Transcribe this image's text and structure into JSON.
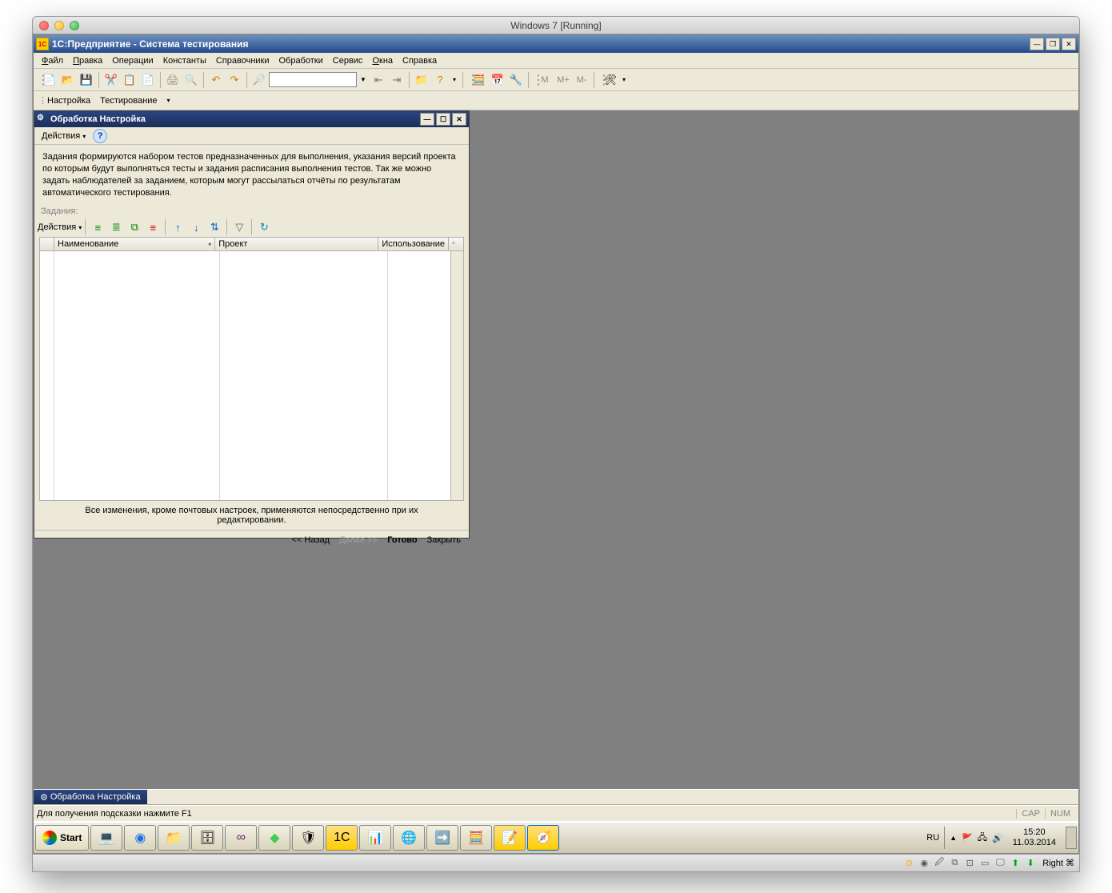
{
  "mac_title": "Windows 7 [Running]",
  "app_title": "1С:Предприятие - Система тестирования",
  "menu": {
    "m1": "Файл",
    "m2": "Правка",
    "m3": "Операции",
    "m4": "Константы",
    "m5": "Справочники",
    "m6": "Обработки",
    "m7": "Сервис",
    "m8": "Окна",
    "m9": "Справка"
  },
  "subbar": {
    "b1": "Настройка",
    "b2": "Тестирование"
  },
  "mdi": {
    "title": "Обработка  Настройка",
    "actions": "Действия",
    "desc": "Задания формируются набором тестов предназначенных для выполнения, указания версий проекта по которым будут выполняться тесты и задания расписания выполнения тестов. Так же можно задать наблюдателей за заданием, которым могут рассылаться отчёты по результатам автоматического тестирования.",
    "section": "Задания:",
    "col1": "Наименование",
    "col2": "Проект",
    "col3": "Использование",
    "footnote": "Все изменения, кроме почтовых настроек, применяются непосредственно при их редактировании.",
    "back": "<< Назад",
    "next": "Далее >>",
    "done": "Готово",
    "close": "Закрыть"
  },
  "tab_label": "Обработка  Настройка",
  "status_hint": "Для получения подсказки нажмите F1",
  "cap": "CAP",
  "num": "NUM",
  "start": "Start",
  "lang": "RU",
  "time": "15:20",
  "date": "11.03.2014",
  "right_ctrl": "Right ⌘"
}
